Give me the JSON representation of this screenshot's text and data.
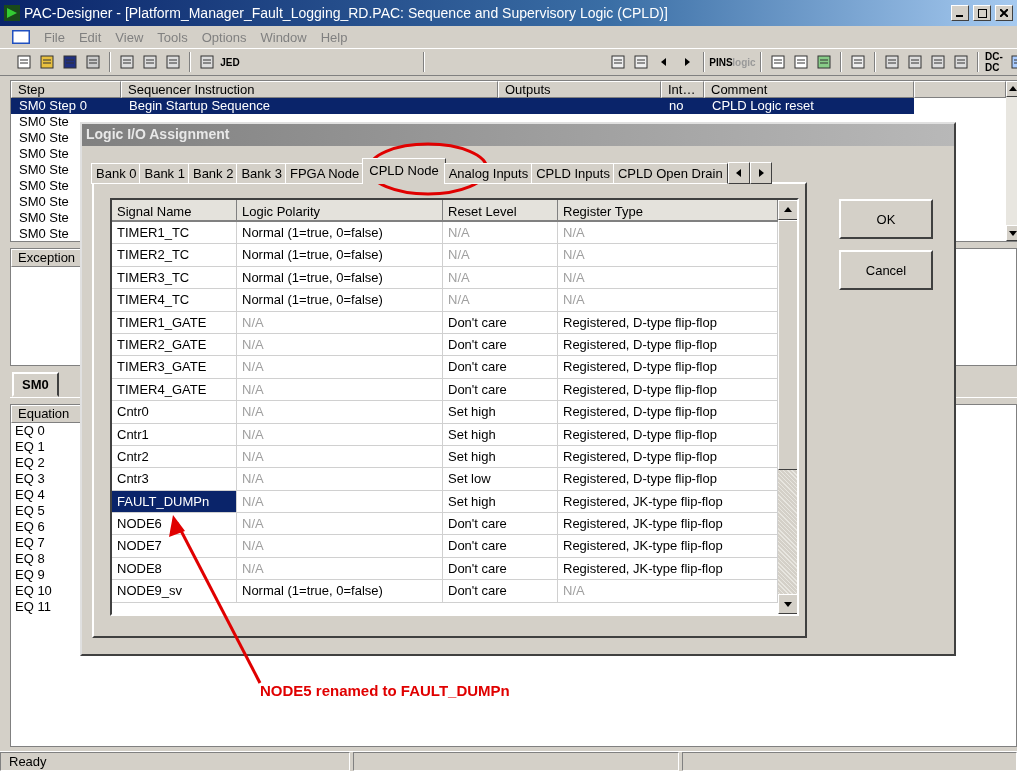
{
  "window": {
    "title": "PAC-Designer - [Platform_Manager_Fault_Logging_RD.PAC: Sequence and Supervisory Logic (CPLD)]"
  },
  "menu": [
    "File",
    "Edit",
    "View",
    "Tools",
    "Options",
    "Window",
    "Help"
  ],
  "toolbar_labels": [
    "JED",
    "PINS",
    "logic",
    "DC-DC"
  ],
  "step_table": {
    "columns": [
      "Step",
      "Sequencer Instruction",
      "Outputs",
      "Int…",
      "Comment"
    ],
    "rows": [
      {
        "selected": true,
        "cells": [
          "SM0  Step 0",
          "Begin Startup Sequence",
          "",
          "no",
          "CPLD Logic reset"
        ]
      },
      {
        "selected": false,
        "cells": [
          "SM0  Ste"
        ]
      },
      {
        "selected": false,
        "cells": [
          "SM0  Ste"
        ]
      },
      {
        "selected": false,
        "cells": [
          "SM0  Ste"
        ]
      },
      {
        "selected": false,
        "cells": [
          "SM0  Ste"
        ]
      },
      {
        "selected": false,
        "cells": [
          "SM0  Ste"
        ]
      },
      {
        "selected": false,
        "cells": [
          "SM0  Ste"
        ]
      },
      {
        "selected": false,
        "cells": [
          "SM0  Ste"
        ]
      },
      {
        "selected": false,
        "cells": [
          "SM0  Ste"
        ]
      }
    ]
  },
  "exception_panel": {
    "header": "Exception"
  },
  "sm_tab": {
    "label": "SM0"
  },
  "equations": {
    "header": "Equation",
    "items": [
      "EQ 0",
      "EQ 1",
      "EQ 2",
      "EQ 3",
      "EQ 4",
      "EQ 5",
      "EQ 6",
      "EQ 7",
      "EQ 8",
      "EQ 9",
      "EQ 10",
      "EQ 11"
    ]
  },
  "status_bar": {
    "text": "Ready"
  },
  "dialog": {
    "title": "Logic I/O Assignment",
    "tabs": [
      {
        "label": "Bank 0",
        "selected": false
      },
      {
        "label": "Bank 1",
        "selected": false
      },
      {
        "label": "Bank 2",
        "selected": false
      },
      {
        "label": "Bank 3",
        "selected": false
      },
      {
        "label": "FPGA Node",
        "selected": false
      },
      {
        "label": "CPLD Node",
        "selected": true
      },
      {
        "label": "Analog Inputs",
        "selected": false
      },
      {
        "label": "CPLD Inputs",
        "selected": false
      },
      {
        "label": "CPLD Open Drain",
        "selected": false
      }
    ],
    "columns": [
      "Signal Name",
      "Logic Polarity",
      "Reset Level",
      "Register Type"
    ],
    "rows": [
      {
        "selected": false,
        "cells": [
          {
            "text": "TIMER1_TC",
            "disabled": false
          },
          {
            "text": "Normal (1=true, 0=false)",
            "disabled": false
          },
          {
            "text": "N/A",
            "disabled": true
          },
          {
            "text": "N/A",
            "disabled": true
          }
        ]
      },
      {
        "selected": false,
        "cells": [
          {
            "text": "TIMER2_TC",
            "disabled": false
          },
          {
            "text": "Normal (1=true, 0=false)",
            "disabled": false
          },
          {
            "text": "N/A",
            "disabled": true
          },
          {
            "text": "N/A",
            "disabled": true
          }
        ]
      },
      {
        "selected": false,
        "cells": [
          {
            "text": "TIMER3_TC",
            "disabled": false
          },
          {
            "text": "Normal (1=true, 0=false)",
            "disabled": false
          },
          {
            "text": "N/A",
            "disabled": true
          },
          {
            "text": "N/A",
            "disabled": true
          }
        ]
      },
      {
        "selected": false,
        "cells": [
          {
            "text": "TIMER4_TC",
            "disabled": false
          },
          {
            "text": "Normal (1=true, 0=false)",
            "disabled": false
          },
          {
            "text": "N/A",
            "disabled": true
          },
          {
            "text": "N/A",
            "disabled": true
          }
        ]
      },
      {
        "selected": false,
        "cells": [
          {
            "text": "TIMER1_GATE",
            "disabled": false
          },
          {
            "text": "N/A",
            "disabled": true
          },
          {
            "text": "Don't care",
            "disabled": false
          },
          {
            "text": "Registered, D-type flip-flop",
            "disabled": false
          }
        ]
      },
      {
        "selected": false,
        "cells": [
          {
            "text": "TIMER2_GATE",
            "disabled": false
          },
          {
            "text": "N/A",
            "disabled": true
          },
          {
            "text": "Don't care",
            "disabled": false
          },
          {
            "text": "Registered, D-type flip-flop",
            "disabled": false
          }
        ]
      },
      {
        "selected": false,
        "cells": [
          {
            "text": "TIMER3_GATE",
            "disabled": false
          },
          {
            "text": "N/A",
            "disabled": true
          },
          {
            "text": "Don't care",
            "disabled": false
          },
          {
            "text": "Registered, D-type flip-flop",
            "disabled": false
          }
        ]
      },
      {
        "selected": false,
        "cells": [
          {
            "text": "TIMER4_GATE",
            "disabled": false
          },
          {
            "text": "N/A",
            "disabled": true
          },
          {
            "text": "Don't care",
            "disabled": false
          },
          {
            "text": "Registered, D-type flip-flop",
            "disabled": false
          }
        ]
      },
      {
        "selected": false,
        "cells": [
          {
            "text": "Cntr0",
            "disabled": false
          },
          {
            "text": "N/A",
            "disabled": true
          },
          {
            "text": "Set high",
            "disabled": false
          },
          {
            "text": "Registered, D-type flip-flop",
            "disabled": false
          }
        ]
      },
      {
        "selected": false,
        "cells": [
          {
            "text": "Cntr1",
            "disabled": false
          },
          {
            "text": "N/A",
            "disabled": true
          },
          {
            "text": "Set high",
            "disabled": false
          },
          {
            "text": "Registered, D-type flip-flop",
            "disabled": false
          }
        ]
      },
      {
        "selected": false,
        "cells": [
          {
            "text": "Cntr2",
            "disabled": false
          },
          {
            "text": "N/A",
            "disabled": true
          },
          {
            "text": "Set high",
            "disabled": false
          },
          {
            "text": "Registered, D-type flip-flop",
            "disabled": false
          }
        ]
      },
      {
        "selected": false,
        "cells": [
          {
            "text": "Cntr3",
            "disabled": false
          },
          {
            "text": "N/A",
            "disabled": true
          },
          {
            "text": "Set low",
            "disabled": false
          },
          {
            "text": "Registered, D-type flip-flop",
            "disabled": false
          }
        ]
      },
      {
        "selected": true,
        "cells": [
          {
            "text": "FAULT_DUMPn",
            "disabled": false
          },
          {
            "text": "N/A",
            "disabled": true
          },
          {
            "text": "Set high",
            "disabled": false
          },
          {
            "text": "Registered, JK-type flip-flop",
            "disabled": false
          }
        ]
      },
      {
        "selected": false,
        "cells": [
          {
            "text": "NODE6",
            "disabled": false
          },
          {
            "text": "N/A",
            "disabled": true
          },
          {
            "text": "Don't care",
            "disabled": false
          },
          {
            "text": "Registered, JK-type flip-flop",
            "disabled": false
          }
        ]
      },
      {
        "selected": false,
        "cells": [
          {
            "text": "NODE7",
            "disabled": false
          },
          {
            "text": "N/A",
            "disabled": true
          },
          {
            "text": "Don't care",
            "disabled": false
          },
          {
            "text": "Registered, JK-type flip-flop",
            "disabled": false
          }
        ]
      },
      {
        "selected": false,
        "cells": [
          {
            "text": "NODE8",
            "disabled": false
          },
          {
            "text": "N/A",
            "disabled": true
          },
          {
            "text": "Don't care",
            "disabled": false
          },
          {
            "text": "Registered, JK-type flip-flop",
            "disabled": false
          }
        ]
      },
      {
        "selected": false,
        "cells": [
          {
            "text": "NODE9_sv",
            "disabled": false
          },
          {
            "text": "Normal (1=true, 0=false)",
            "disabled": false
          },
          {
            "text": "Don't care",
            "disabled": false
          },
          {
            "text": "N/A",
            "disabled": true
          }
        ]
      }
    ],
    "buttons": [
      "OK",
      "Cancel"
    ]
  },
  "annotation": {
    "text": "NODE5 renamed to FAULT_DUMPn"
  }
}
